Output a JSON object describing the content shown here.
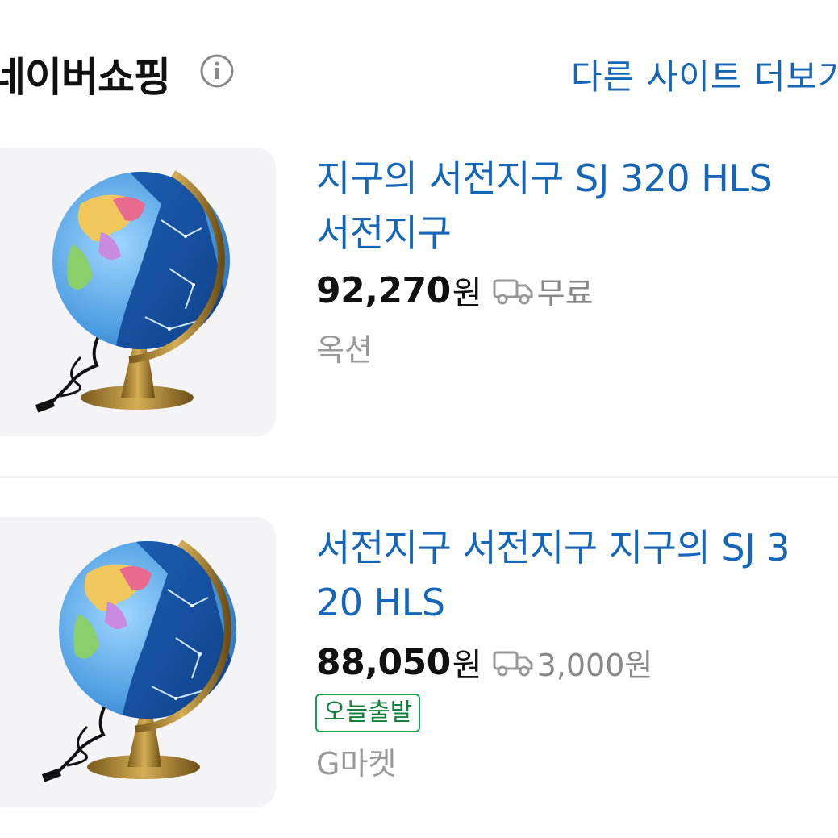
{
  "header": {
    "title": "네이버쇼핑",
    "info_icon": "info-circle-icon",
    "more_link": "다른 사이트 더보기"
  },
  "products": [
    {
      "title_line1": "지구의 서전지구 SJ 320 HLS",
      "title_line2": "서전지구",
      "price": "92,270",
      "currency": "원",
      "shipping_icon": "truck-icon",
      "shipping": "무료",
      "seller": "옥션",
      "thumbnail": "globe-image"
    },
    {
      "title_line1": "서전지구 서전지구 지구의 SJ 3",
      "title_line2": "20 HLS",
      "price": "88,050",
      "currency": "원",
      "shipping_icon": "truck-icon",
      "shipping": "3,000원",
      "badge": "오늘출발",
      "seller": "G마켓",
      "thumbnail": "globe-image"
    }
  ],
  "colors": {
    "link": "#1666b8",
    "price": "#111111",
    "muted": "#888888",
    "badge": "#16a34a"
  }
}
